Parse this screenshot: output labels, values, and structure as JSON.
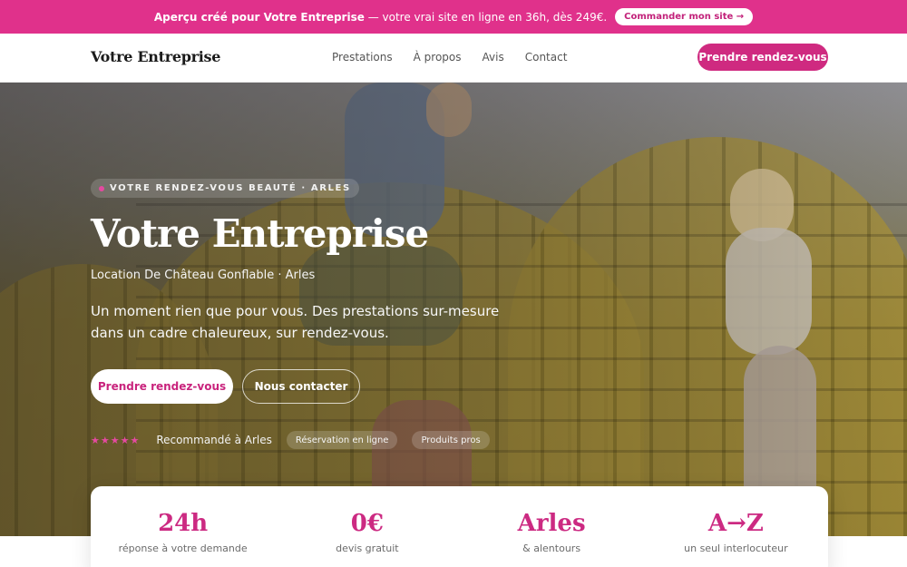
{
  "promo": {
    "text_bold": "Aperçu créé pour Votre Entreprise",
    "text_rest": " — votre vrai site en ligne en 36h, dès 249€.",
    "cta": "Commander mon site →"
  },
  "header": {
    "brand": "Votre Entreprise",
    "nav": [
      "Prestations",
      "À propos",
      "Avis",
      "Contact"
    ],
    "cta": "Prendre rendez-vous"
  },
  "hero": {
    "tagline": "VOTRE RENDEZ-VOUS BEAUTÉ · ARLES",
    "title": "Votre Entreprise",
    "subtitle": "Location De Château Gonflable · Arles",
    "description": "Un moment rien que pour vous. Des prestations sur-mesure dans un cadre chaleureux, sur rendez-vous.",
    "primary_button": "Prendre rendez-vous",
    "secondary_button": "Nous contacter",
    "stars": "★★★★★",
    "recommendation": "Recommandé à Arles",
    "pills": [
      "Réservation en ligne",
      "Produits pros"
    ]
  },
  "stats": [
    {
      "value": "24h",
      "label": "réponse à votre demande"
    },
    {
      "value": "0€",
      "label": "devis gratuit"
    },
    {
      "value": "Arles",
      "label": "& alentours"
    },
    {
      "value": "A→Z",
      "label": "un seul interlocuteur"
    }
  ],
  "colors": {
    "accent": "#e0318b",
    "accent_dark": "#cf2a80"
  }
}
